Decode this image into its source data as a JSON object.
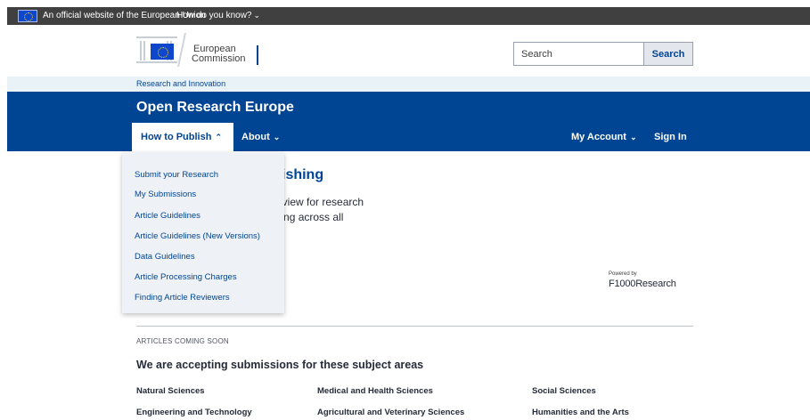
{
  "eu_bar": {
    "official_text": "An official website of the European Union",
    "how_text": "How do you know?"
  },
  "header": {
    "logo_line1": "European",
    "logo_line2": "Commission",
    "search_placeholder": "Search",
    "search_button": "Search"
  },
  "breadcrumb": {
    "label": "Research and Innovation"
  },
  "site": {
    "title": "Open Research Europe"
  },
  "nav": {
    "how_to_publish": "How to Publish",
    "about": "About",
    "my_account": "My Account",
    "sign_in": "Sign In"
  },
  "dropdown": {
    "items": [
      "Submit your Research",
      "My Submissions",
      "Article Guidelines",
      "Article Guidelines (New Versions)",
      "Data Guidelines",
      "Article Processing Charges",
      "Finding Article Reviewers"
    ]
  },
  "hero": {
    "title_visible": "ublishing",
    "line1_visible": "er review for research",
    "line2_visible": "funding across all"
  },
  "powered": {
    "by": "Powered by",
    "brand": "F1000Research"
  },
  "articles": {
    "coming_soon": "ARTICLES COMING SOON",
    "heading": "We are accepting submissions for these subject areas",
    "subjects": [
      "Natural Sciences",
      "Medical and Health Sciences",
      "Social Sciences",
      "Engineering and Technology",
      "Agricultural and Veterinary Sciences",
      "Humanities and the Arts"
    ]
  },
  "colors": {
    "brand_blue": "#004494",
    "eu_bar": "#404040",
    "ri_bar": "#e9f2f7",
    "dropdown_bg": "#eef2f6"
  }
}
